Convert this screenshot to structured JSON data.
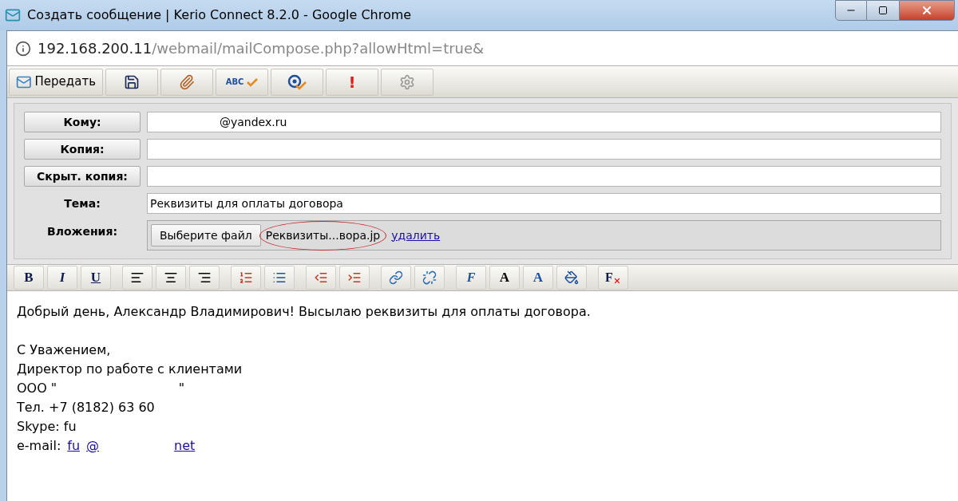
{
  "window": {
    "title": "Создать сообщение | Kerio Connect 8.2.0 - Google Chrome"
  },
  "address": {
    "host": "192.168.200.11",
    "path": "/webmail/mailCompose.php?allowHtml=true&"
  },
  "toolbar": [
    {
      "kind": "send",
      "label": "Передать"
    },
    {
      "kind": "save"
    },
    {
      "kind": "attach"
    },
    {
      "kind": "spell",
      "label": "ABC"
    },
    {
      "kind": "address"
    },
    {
      "kind": "priority",
      "label": "!"
    },
    {
      "kind": "settings"
    }
  ],
  "form": {
    "to": {
      "label": "Кому:",
      "value": "@yandex.ru"
    },
    "cc": {
      "label": "Копия:"
    },
    "bcc": {
      "label": "Скрыт. копия:"
    },
    "subject": {
      "label": "Тема:",
      "value": "Реквизиты для оплаты договора"
    },
    "attachments": {
      "label": "Вложения:",
      "button": "Выберите файл",
      "file": "Реквизиты...вора.jp",
      "remove": "удалить"
    }
  },
  "format_toolbar": [
    {
      "kind": "bold",
      "label": "B"
    },
    {
      "kind": "italic",
      "label": "I"
    },
    {
      "kind": "underline",
      "label": "U"
    },
    {
      "kind": "sep"
    },
    {
      "kind": "align-left"
    },
    {
      "kind": "align-center"
    },
    {
      "kind": "align-right"
    },
    {
      "kind": "sep"
    },
    {
      "kind": "ordered-list"
    },
    {
      "kind": "bullet-list"
    },
    {
      "kind": "sep"
    },
    {
      "kind": "outdent"
    },
    {
      "kind": "indent"
    },
    {
      "kind": "sep"
    },
    {
      "kind": "link"
    },
    {
      "kind": "unlink"
    },
    {
      "kind": "sep"
    },
    {
      "kind": "font",
      "label": "F"
    },
    {
      "kind": "size",
      "label": "A"
    },
    {
      "kind": "color",
      "label": "A"
    },
    {
      "kind": "fill"
    },
    {
      "kind": "sep"
    },
    {
      "kind": "clear",
      "label": "F"
    }
  ],
  "body": [
    {
      "kind": "text",
      "text": "Добрый день, Александр Владимирович! Высылаю реквизиты для оплаты договора."
    },
    {
      "kind": "blank"
    },
    {
      "kind": "text",
      "text": "С Уважением,"
    },
    {
      "kind": "text",
      "text": "Директор по работе с клиентами"
    },
    {
      "kind": "text",
      "text": "ООО \"                              \""
    },
    {
      "kind": "text",
      "text": "Тел. +7 (8182) 63 60"
    },
    {
      "kind": "text",
      "text": "Skype: fu"
    },
    {
      "kind": "links",
      "label": "e-mail:",
      "links": [
        "fu",
        "@",
        "net"
      ]
    }
  ]
}
